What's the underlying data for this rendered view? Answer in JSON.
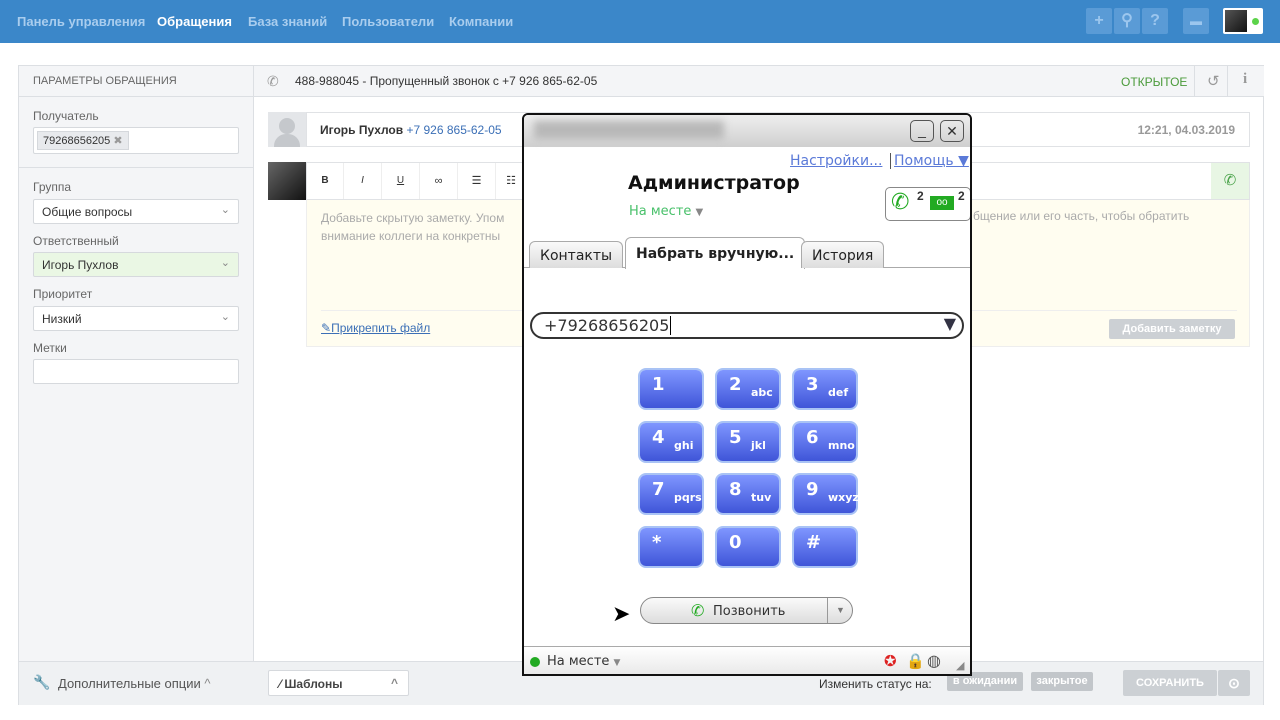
{
  "nav": {
    "items": [
      "Панель управления",
      "Обращения",
      "База знаний",
      "Пользователи",
      "Компании"
    ],
    "active": 1
  },
  "topbar": {
    "icons": [
      "plus-icon",
      "search-icon",
      "help-icon",
      "briefcase-icon"
    ],
    "plus": "+",
    "search": "⚲",
    "help": "?",
    "briefcase": "▬"
  },
  "sidebar": {
    "title": "ПАРАМЕТРЫ ОБРАЩЕНИЯ",
    "recipient_label": "Получатель",
    "recipient_tag": "79268656205",
    "group_label": "Группа",
    "group_value": "Общие вопросы",
    "assignee_label": "Ответственный",
    "assignee_value": "Игорь Пухлов",
    "priority_label": "Приоритет",
    "priority_value": "Низкий",
    "tags_label": "Метки",
    "tags_value": "",
    "more_options": "Дополнительные опции"
  },
  "ticket": {
    "title": "488-988045 - Пропущенный звонок с +7 926 865-62-05",
    "status": "ОТКРЫТОЕ",
    "status_color": "#4a9a3a",
    "author": "Игорь Пухлов",
    "phone": "+7 926 865-62-05",
    "time": "12:21, 04.03.2019"
  },
  "editor": {
    "toolbar": [
      "B",
      "I",
      "U",
      "∞",
      "☰",
      "☷"
    ],
    "placeholder_left": "Добавьте скрытую заметку. Упом",
    "placeholder_left2": "внимание коллеги на конкретны",
    "placeholder_right": "бщение или его часть, чтобы обратить",
    "attach": "Прикрепить файл",
    "add_note": "Добавить заметку"
  },
  "footer": {
    "templates": "Шаблоны",
    "change_status": "Изменить статус на:",
    "status_pending": "в ожидании",
    "status_closed": "закрытое",
    "save": "СОХРАНИТЬ"
  },
  "phone": {
    "settings": "Настройки...",
    "help": "Помощь ▼",
    "user": "Администратор",
    "presence": "На месте",
    "missed_calls": "2",
    "voicemails": "2",
    "tabs": [
      "Контакты",
      "Набрать вручную...",
      "История"
    ],
    "active_tab": 1,
    "number": "+79268656205",
    "keys": [
      [
        "1",
        ""
      ],
      [
        "2",
        "abc"
      ],
      [
        "3",
        "def"
      ],
      [
        "4",
        "ghi"
      ],
      [
        "5",
        "jkl"
      ],
      [
        "6",
        "mno"
      ],
      [
        "7",
        "pqrs"
      ],
      [
        "8",
        "tuv"
      ],
      [
        "9",
        "wxyz"
      ],
      [
        "*",
        ""
      ],
      [
        "0",
        ""
      ],
      [
        "#",
        ""
      ]
    ],
    "call": "Позвонить",
    "status": "На месте",
    "presence_color": "#22aa22"
  }
}
